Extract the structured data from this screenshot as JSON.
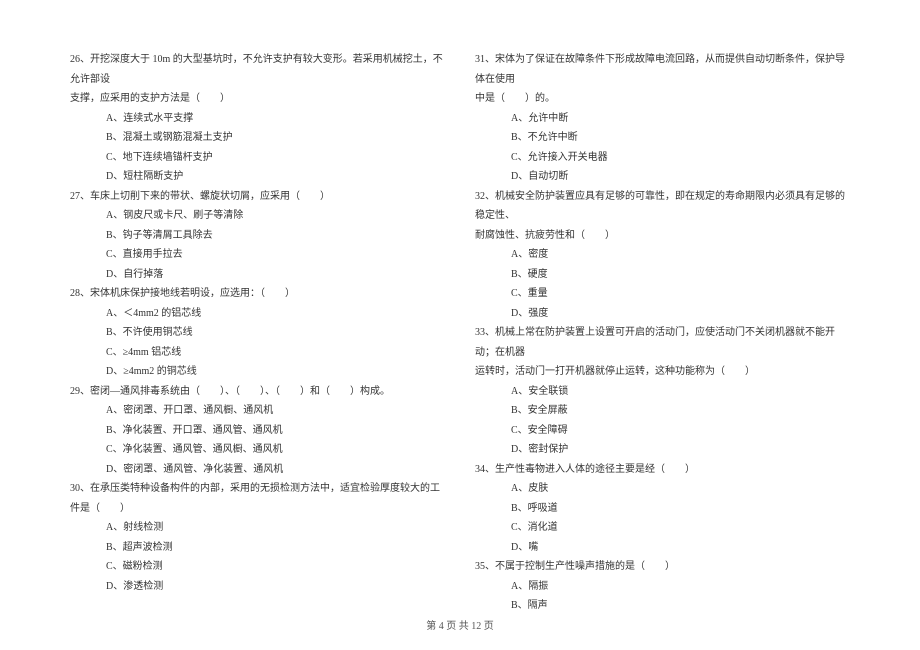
{
  "left": {
    "q26": {
      "text": "26、开挖深度大于 10m 的大型基坑时，不允许支护有较大变形。若采用机械挖土，不允许部设",
      "text2": "支撑，应采用的支护方法是（　　）",
      "a": "A、连续式水平支撑",
      "b": "B、混凝土或钢筋混凝土支护",
      "c": "C、地下连续墙锚杆支护",
      "d": "D、短柱隔断支护"
    },
    "q27": {
      "text": "27、车床上切削下来的带状、螺旋状切屑，应采用（　　）",
      "a": "A、钢皮尺或卡尺、刷子等清除",
      "b": "B、钩子等清屑工具除去",
      "c": "C、直接用手拉去",
      "d": "D、自行掉落"
    },
    "q28": {
      "text": "28、宋体机床保护接地线若明设，应选用：（　　）",
      "a": "A、＜4mm2 的铝芯线",
      "b": "B、不许使用铜芯线",
      "c": "C、≥4mm 铝芯线",
      "d": "D、≥4mm2 的铜芯线"
    },
    "q29": {
      "text": "29、密闭—通风排毒系统由（　　）、（　　）、（　　）和（　　）构成。",
      "a": "A、密闭罩、开口罩、通风橱、通风机",
      "b": "B、净化装置、开口罩、通风管、通风机",
      "c": "C、净化装置、通风管、通风橱、通风机",
      "d": "D、密闭罩、通风管、净化装置、通风机"
    },
    "q30": {
      "text": "30、在承压类特种设备构件的内部，采用的无损检测方法中，适宜检验厚度较大的工件是（　　）",
      "a": "A、射线检测",
      "b": "B、超声波检测",
      "c": "C、磁粉检测",
      "d": "D、渗透检测"
    }
  },
  "right": {
    "q31": {
      "text": "31、宋体为了保证在故障条件下形成故障电流回路，从而提供自动切断条件，保护导体在使用",
      "text2": "中是（　　）的。",
      "a": "A、允许中断",
      "b": "B、不允许中断",
      "c": "C、允许接入开关电器",
      "d": "D、自动切断"
    },
    "q32": {
      "text": "32、机械安全防护装置应具有足够的可靠性，即在规定的寿命期限内必须具有足够的稳定性、",
      "text2": "耐腐蚀性、抗疲劳性和（　　）",
      "a": "A、密度",
      "b": "B、硬度",
      "c": "C、重量",
      "d": "D、强度"
    },
    "q33": {
      "text": "33、机械上常在防护装置上设置可开启的活动门，应使活动门不关闭机器就不能开动；在机器",
      "text2": "运转时，活动门一打开机器就停止运转，这种功能称为（　　）",
      "a": "A、安全联锁",
      "b": "B、安全屏蔽",
      "c": "C、安全障碍",
      "d": "D、密封保护"
    },
    "q34": {
      "text": "34、生产性毒物进入人体的途径主要是经（　　）",
      "a": "A、皮肤",
      "b": "B、呼吸道",
      "c": "C、消化道",
      "d": "D、嘴"
    },
    "q35": {
      "text": "35、不属于控制生产性噪声措施的是（　　）",
      "a": "A、隔振",
      "b": "B、隔声"
    }
  },
  "footer": "第 4 页 共 12 页"
}
